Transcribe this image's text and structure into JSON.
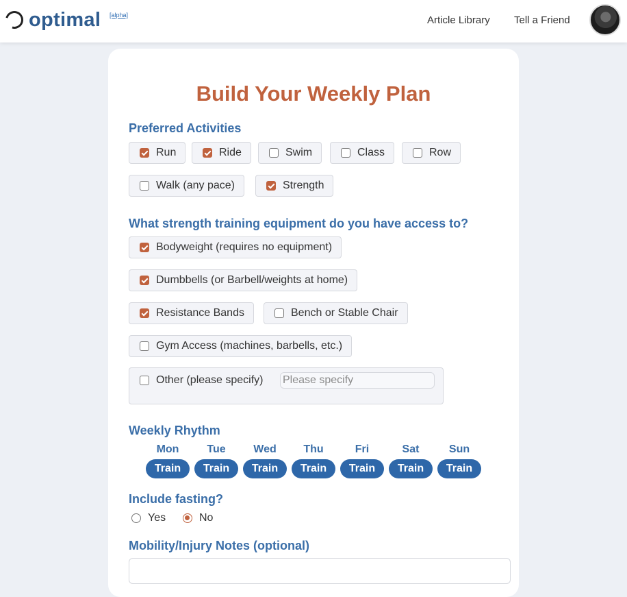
{
  "header": {
    "brand": "optimal",
    "badge": "[alpha]",
    "nav": [
      "Article Library",
      "Tell a Friend"
    ]
  },
  "form": {
    "title": "Build Your Weekly Plan",
    "preferred_activities": {
      "label": "Preferred Activities",
      "options": [
        {
          "label": "Run",
          "checked": true
        },
        {
          "label": "Ride",
          "checked": true
        },
        {
          "label": "Swim",
          "checked": false
        },
        {
          "label": "Class",
          "checked": false
        },
        {
          "label": "Row",
          "checked": false
        },
        {
          "label": "Walk (any pace)",
          "checked": false
        },
        {
          "label": "Strength",
          "checked": true
        }
      ]
    },
    "equipment": {
      "label": "What strength training equipment do you have access to?",
      "options": [
        {
          "label": "Bodyweight (requires no equipment)",
          "checked": true
        },
        {
          "label": "Dumbbells (or Barbell/weights at home)",
          "checked": true
        },
        {
          "label": "Resistance Bands",
          "checked": true
        },
        {
          "label": "Bench or Stable Chair",
          "checked": false
        },
        {
          "label": "Gym Access (machines, barbells, etc.)",
          "checked": false
        }
      ],
      "other": {
        "label": "Other (please specify)",
        "checked": false,
        "placeholder": "Please specify",
        "value": ""
      }
    },
    "weekly_rhythm": {
      "label": "Weekly Rhythm",
      "days": [
        {
          "day": "Mon",
          "mode": "Train"
        },
        {
          "day": "Tue",
          "mode": "Train"
        },
        {
          "day": "Wed",
          "mode": "Train"
        },
        {
          "day": "Thu",
          "mode": "Train"
        },
        {
          "day": "Fri",
          "mode": "Train"
        },
        {
          "day": "Sat",
          "mode": "Train"
        },
        {
          "day": "Sun",
          "mode": "Train"
        }
      ]
    },
    "fasting": {
      "label": "Include fasting?",
      "options": [
        {
          "label": "Yes",
          "checked": false
        },
        {
          "label": "No",
          "checked": true
        }
      ]
    },
    "notes": {
      "label": "Mobility/Injury Notes (optional)",
      "value": ""
    }
  },
  "colors": {
    "accent": "#c0623e",
    "brand_blue": "#3a6ea8",
    "button_blue": "#2e67a9"
  }
}
